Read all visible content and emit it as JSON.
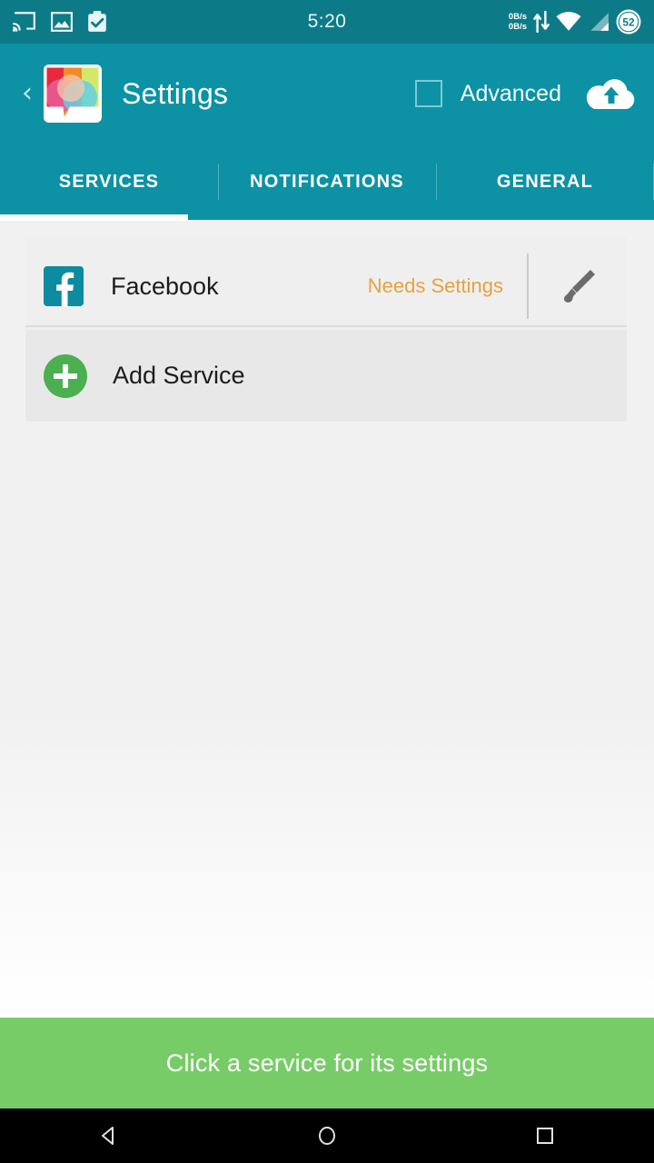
{
  "status_bar": {
    "time": "5:20",
    "network_speed_up": "0B/s",
    "network_speed_down": "0B/s",
    "battery_level": "52",
    "icons": [
      "cast-icon",
      "image-icon",
      "clipboard-check-icon",
      "data-transfer-icon",
      "wifi-icon",
      "cell-signal-icon",
      "battery-icon"
    ],
    "background_color": "#0d7b87"
  },
  "app_bar": {
    "back_label": "‹",
    "title": "Settings",
    "advanced_label": "Advanced",
    "advanced_checked": false,
    "cloud_upload_name": "cloud-upload-icon",
    "background_color": "#0c92a4"
  },
  "tabs": {
    "items": [
      {
        "label": "SERVICES",
        "active": true
      },
      {
        "label": "NOTIFICATIONS",
        "active": false
      },
      {
        "label": "GENERAL",
        "active": false
      }
    ],
    "indicator_color": "#ffffff"
  },
  "services": {
    "rows": [
      {
        "name": "Facebook",
        "status": "Needs Settings",
        "status_color": "#e7a33b",
        "icon_letter": "f",
        "icon_color": "#0d8ba0",
        "action": "edit-brush-icon"
      }
    ],
    "add_service_label": "Add Service",
    "add_service_color": "#4caf50"
  },
  "toast": {
    "message": "Click a service for its settings",
    "background_color": "#78cc68"
  },
  "nav_bar": {
    "back": "back-triangle-icon",
    "home": "home-circle-icon",
    "recents": "recents-square-icon"
  }
}
